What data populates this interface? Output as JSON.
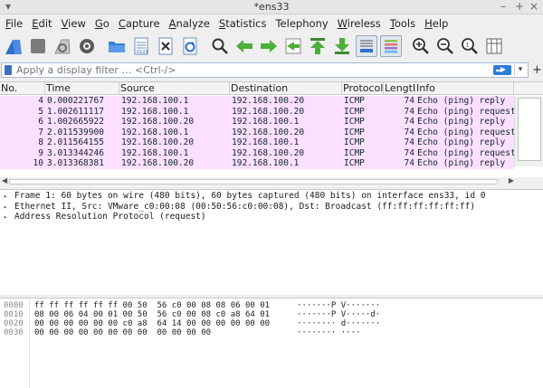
{
  "window": {
    "title": "*ens33",
    "menu_glyph": "▾",
    "min_glyph": "–",
    "max_glyph": "+",
    "close_glyph": "×"
  },
  "menubar": [
    {
      "label": "File",
      "key": "F",
      "rest": "ile"
    },
    {
      "label": "Edit",
      "key": "E",
      "rest": "dit"
    },
    {
      "label": "View",
      "key": "V",
      "rest": "iew"
    },
    {
      "label": "Go",
      "key": "G",
      "rest": "o"
    },
    {
      "label": "Capture",
      "key": "C",
      "rest": "apture"
    },
    {
      "label": "Analyze",
      "key": "A",
      "rest": "nalyze"
    },
    {
      "label": "Statistics",
      "key": "S",
      "rest": "tatistics"
    },
    {
      "label": "Telephony",
      "key": "",
      "rest": "Telephony"
    },
    {
      "label": "Wireless",
      "key": "W",
      "rest": "ireless"
    },
    {
      "label": "Tools",
      "key": "T",
      "rest": "ools"
    },
    {
      "label": "Help",
      "key": "H",
      "rest": "elp"
    }
  ],
  "toolbar": {
    "icons": [
      "start-capture-icon",
      "stop-capture-icon",
      "restart-capture-icon",
      "capture-options-icon",
      "open-file-icon",
      "save-file-icon",
      "close-file-icon",
      "reload-file-icon",
      "find-packet-icon",
      "go-back-icon",
      "go-forward-icon",
      "go-to-packet-icon",
      "go-first-icon",
      "go-last-icon",
      "auto-scroll-icon",
      "colorize-icon",
      "zoom-in-icon",
      "zoom-out-icon",
      "zoom-reset-icon",
      "resize-columns-icon"
    ],
    "accent": "#2f6fc7",
    "green": "#4caf3a"
  },
  "filter": {
    "placeholder": "Apply a display filter … <Ctrl-/>",
    "dropdown_glyph": "▾",
    "add_glyph": "+"
  },
  "packet_list": {
    "columns": [
      "No.",
      "Time",
      "Source",
      "Destination",
      "Protocol",
      "Length",
      "Info"
    ],
    "row_color": "#fce0ff",
    "rows": [
      {
        "no": "4",
        "time": "0.000221767",
        "src": "192.168.100.1",
        "dst": "192.168.100.20",
        "proto": "ICMP",
        "len": "74",
        "info": "Echo (ping) reply"
      },
      {
        "no": "5",
        "time": "1.002611117",
        "src": "192.168.100.1",
        "dst": "192.168.100.20",
        "proto": "ICMP",
        "len": "74",
        "info": "Echo (ping) request"
      },
      {
        "no": "6",
        "time": "1.002665922",
        "src": "192.168.100.20",
        "dst": "192.168.100.1",
        "proto": "ICMP",
        "len": "74",
        "info": "Echo (ping) reply"
      },
      {
        "no": "7",
        "time": "2.011539900",
        "src": "192.168.100.1",
        "dst": "192.168.100.20",
        "proto": "ICMP",
        "len": "74",
        "info": "Echo (ping) request"
      },
      {
        "no": "8",
        "time": "2.011564155",
        "src": "192.168.100.20",
        "dst": "192.168.100.1",
        "proto": "ICMP",
        "len": "74",
        "info": "Echo (ping) reply"
      },
      {
        "no": "9",
        "time": "3.013344246",
        "src": "192.168.100.1",
        "dst": "192.168.100.20",
        "proto": "ICMP",
        "len": "74",
        "info": "Echo (ping) request"
      },
      {
        "no": "10",
        "time": "3.013368381",
        "src": "192.168.100.20",
        "dst": "192.168.100.1",
        "proto": "ICMP",
        "len": "74",
        "info": "Echo (ping) reply"
      }
    ]
  },
  "details": [
    {
      "glyph": "▸",
      "text": "Frame 1: 60 bytes on wire (480 bits), 60 bytes captured (480 bits) on interface ens33, id 0"
    },
    {
      "glyph": "▸",
      "text": "Ethernet II, Src: VMware_c0:00:08 (00:50:56:c0:00:08), Dst: Broadcast (ff:ff:ff:ff:ff:ff)"
    },
    {
      "glyph": "▸",
      "text": "Address Resolution Protocol (request)"
    }
  ],
  "bytes": [
    {
      "offset": "0000",
      "hex": "ff ff ff ff ff ff 00 50  56 c0 00 08 08 06 00 01",
      "ascii": "·······P V·······"
    },
    {
      "offset": "0010",
      "hex": "08 00 06 04 00 01 00 50  56 c0 00 08 c0 a8 64 01",
      "ascii": "·······P V·····d·"
    },
    {
      "offset": "0020",
      "hex": "00 00 00 00 00 00 c0 a8  64 14 00 00 00 00 00 00",
      "ascii": "········ d·······"
    },
    {
      "offset": "0030",
      "hex": "00 00 00 00 00 00 00 00  00 00 00 00",
      "ascii": "········ ····"
    }
  ]
}
